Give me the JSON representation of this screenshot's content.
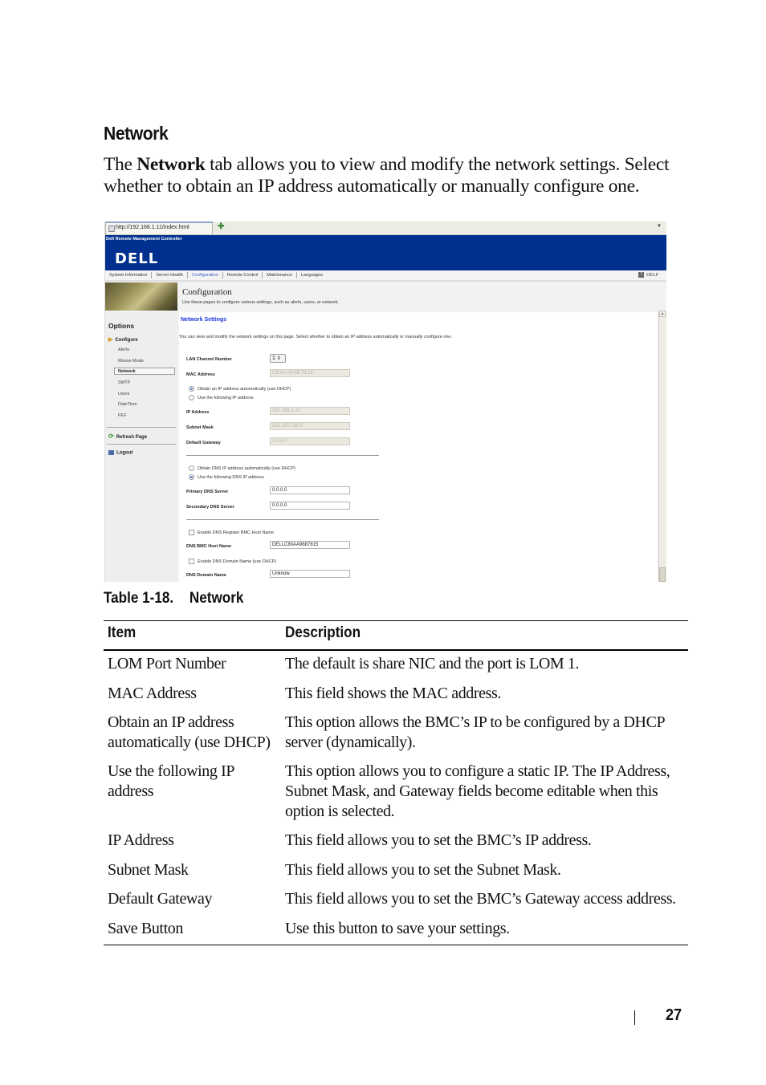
{
  "section": {
    "heading": "Network",
    "intro_pre": "The ",
    "intro_bold": "Network",
    "intro_post": " tab allows you to view and modify the network settings. Select whether to obtain an IP address automatically or manually configure one."
  },
  "screenshot": {
    "browser": {
      "tab_url": "http://192.168.1.11/index.html",
      "new_tab_icon": "plus-icon",
      "menu_icon": "chevron-down-icon"
    },
    "banner": {
      "title": "Dell Remote Management Controller",
      "logo": "DELL",
      "color": "#00308f"
    },
    "nav": {
      "items": [
        "System Information",
        "Server Health",
        "Configuration",
        "Remote Control",
        "Maintenance",
        "Languages"
      ],
      "active": "Configuration",
      "help": "HELP"
    },
    "header": {
      "title": "Configuration",
      "subtitle": "Use these pages to configure various settings, such as alerts, users, or network."
    },
    "sidebar": {
      "options_label": "Options",
      "configure_label": "Configure",
      "items": [
        "Alerts",
        "Mouse Mode",
        "Network",
        "SMTP",
        "Users",
        "DateTime",
        "PEF"
      ],
      "selected": "Network",
      "refresh": "Refresh Page",
      "logout": "Logout"
    },
    "network": {
      "title": "Network Settings",
      "description": "You can view and modify the network settings on this page. Select whether to obtain an IP address automatically or manually configure one.",
      "lan_channel_label": "LAN Channel Number",
      "lan_channel_value": "1",
      "mac_label": "MAC Address",
      "mac_value": "C8:0A:A9:88:78:15",
      "radio_dhcp": "Obtain an IP address automatically (use DHCP)",
      "radio_static": "Use the following IP address",
      "ip_label": "IP Address",
      "ip_value": "192.168.1.11",
      "subnet_label": "Subnet Mask",
      "subnet_value": "255.255.255.0",
      "gateway_label": "Default Gateway",
      "gateway_value": "0.0.0.0",
      "dns_radio_dhcp": "Obtain DNS IP address automatically (use DHCP)",
      "dns_radio_static": "Use the following DNS IP address",
      "primary_dns_label": "Primary DNS Server",
      "primary_dns_value": "0.0.0.0",
      "secondary_dns_label": "Secondary DNS Server",
      "secondary_dns_value": "0.0.0.0",
      "enable_register_label": "Enable DNS Register BMC Host Name",
      "host_name_label": "DNS BMC Host Name",
      "host_name_value": "DELLC80AA9887815",
      "enable_domain_label": "Enable DNS Domain Name (use DHCP)",
      "domain_label": "DNS Domain Name",
      "domain_value": "Unknow"
    }
  },
  "table": {
    "caption_num": "Table 1-18.",
    "caption_title": "Network",
    "headers": [
      "Item",
      "Description"
    ],
    "rows": [
      {
        "item": "LOM Port Number",
        "desc": "The default is share NIC and the port is LOM 1."
      },
      {
        "item": "MAC Address",
        "desc": "This field shows the MAC address."
      },
      {
        "item": "Obtain an IP address automatically (use DHCP)",
        "desc": "This option allows the BMC’s IP to be configured by a DHCP server (dynamically)."
      },
      {
        "item": "Use the following IP address",
        "desc": "This option allows you to configure a static IP. The IP Address, Subnet Mask, and Gateway fields become editable when this option is selected."
      },
      {
        "item": "IP Address",
        "desc": "This field allows you to set the BMC’s IP address."
      },
      {
        "item": "Subnet Mask",
        "desc": "This field allows you to set the Subnet Mask."
      },
      {
        "item": "Default Gateway",
        "desc": "This field allows you to set the BMC’s Gateway access address."
      },
      {
        "item": "Save Button",
        "desc": "Use this button to save your settings."
      }
    ]
  },
  "footer": {
    "page_number": "27"
  }
}
